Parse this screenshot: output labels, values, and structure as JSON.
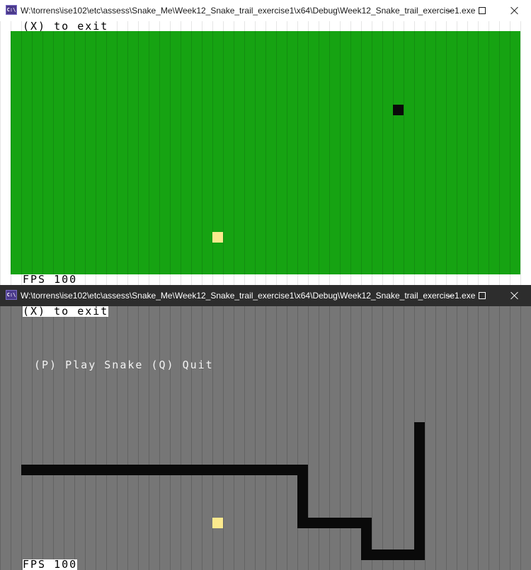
{
  "windows": [
    {
      "title": "W:\\torrens\\ise102\\etc\\assess\\Snake_Me\\Week12_Snake_trail_exercise1\\x64\\Debug\\Week12_Snake_trail_exercise1.exe",
      "icon_text": "C:\\",
      "exit_hint": "(X) to exit",
      "fps_label": "FPS 100"
    },
    {
      "title": "W:\\torrens\\ise102\\etc\\assess\\Snake_Me\\Week12_Snake_trail_exercise1\\x64\\Debug\\Week12_Snake_trail_exercise1.exe",
      "icon_text": "C:\\",
      "exit_hint": "(X) to exit",
      "menu_prompt": "(P) Play Snake (Q) Quit",
      "fps_label": "FPS 100"
    }
  ],
  "colors": {
    "field_green": "#16a312",
    "food_yellow": "#fbe98d",
    "snake_black": "#0a0a0a",
    "console_gray": "#767676",
    "dark_titlebar": "#2d2d2d"
  },
  "icons": {
    "minimize": "minimize-icon",
    "maximize": "maximize-icon",
    "close": "close-icon",
    "app": "console-app-icon"
  }
}
